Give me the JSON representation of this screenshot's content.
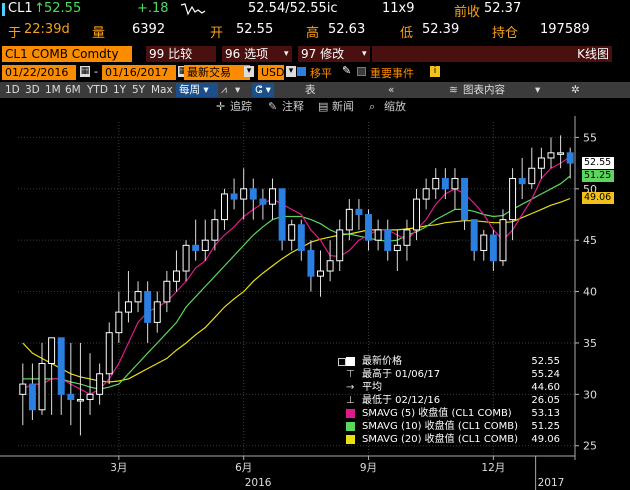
{
  "quote": {
    "ticker": "CL1",
    "last": "52.55",
    "change": "+.18",
    "bid_ask": "52.54/52.55ic",
    "size": "11x9",
    "prev_close_label": "前收",
    "prev_close": "52.37",
    "time_prefix": "于",
    "time": "22:39d",
    "volume_label": "量",
    "volume": "6392",
    "open_label": "开",
    "open": "52.55",
    "high_label": "高",
    "high": "52.63",
    "low_label": "低",
    "low": "52.39",
    "oi_label": "持仓",
    "oi": "197589"
  },
  "function_bar": {
    "security": "CL1 COMB Comdty",
    "compare": "99 比较",
    "options": "96 选项",
    "modify": "97 修改",
    "chart_name": "K线图"
  },
  "settings_bar": {
    "start_date": "01/22/2016",
    "end_date": "01/16/2017",
    "last_trade": "最新交易",
    "currency": "USD",
    "move_label": "移平",
    "events_label": "重要事件"
  },
  "period_bar": {
    "periods": [
      "1D",
      "3D",
      "1M",
      "6M",
      "YTD",
      "1Y",
      "5Y",
      "Max"
    ],
    "frequency": "每周",
    "table_label": "表",
    "chart_content": "图表内容"
  },
  "tools_bar": {
    "track": "追踪",
    "annotate": "注释",
    "news": "新闻",
    "zoom": "缩放"
  },
  "chart_data": {
    "type": "candlestick",
    "y_ticks": [
      25,
      30,
      35,
      40,
      45,
      50,
      55
    ],
    "ylim": [
      24,
      56.5
    ],
    "x_month_labels": [
      "3月",
      "6月",
      "9月",
      "12月"
    ],
    "x_year_labels": [
      "2016",
      "2017"
    ],
    "candles": [
      {
        "o": 30,
        "h": 33,
        "l": 27,
        "c": 31
      },
      {
        "o": 31,
        "h": 33,
        "l": 27.5,
        "c": 28.5
      },
      {
        "o": 28.5,
        "h": 35,
        "l": 28,
        "c": 33
      },
      {
        "o": 33,
        "h": 35,
        "l": 28,
        "c": 35.5
      },
      {
        "o": 35.5,
        "h": 35,
        "l": 28,
        "c": 30
      },
      {
        "o": 30,
        "h": 35,
        "l": 27,
        "c": 29.5
      },
      {
        "o": 29.5,
        "h": 35,
        "l": 26,
        "c": 29.5
      },
      {
        "o": 29.5,
        "h": 34,
        "l": 28,
        "c": 30
      },
      {
        "o": 30,
        "h": 33,
        "l": 29,
        "c": 32
      },
      {
        "o": 32,
        "h": 37,
        "l": 31,
        "c": 36
      },
      {
        "o": 36,
        "h": 40,
        "l": 35,
        "c": 38
      },
      {
        "o": 38,
        "h": 42,
        "l": 37,
        "c": 39
      },
      {
        "o": 39,
        "h": 41,
        "l": 38,
        "c": 40
      },
      {
        "o": 40,
        "h": 41,
        "l": 35,
        "c": 37
      },
      {
        "o": 37,
        "h": 40,
        "l": 36,
        "c": 39
      },
      {
        "o": 39,
        "h": 42,
        "l": 38,
        "c": 41
      },
      {
        "o": 41,
        "h": 44,
        "l": 40,
        "c": 42
      },
      {
        "o": 42,
        "h": 45,
        "l": 41,
        "c": 44.5
      },
      {
        "o": 44.5,
        "h": 47,
        "l": 43,
        "c": 44
      },
      {
        "o": 44,
        "h": 47,
        "l": 43,
        "c": 45
      },
      {
        "o": 45,
        "h": 48,
        "l": 44,
        "c": 47
      },
      {
        "o": 47,
        "h": 50,
        "l": 46,
        "c": 49.5
      },
      {
        "o": 49.5,
        "h": 51,
        "l": 48,
        "c": 49
      },
      {
        "o": 49,
        "h": 52,
        "l": 47,
        "c": 50
      },
      {
        "o": 50,
        "h": 51,
        "l": 47,
        "c": 49
      },
      {
        "o": 49,
        "h": 50,
        "l": 47,
        "c": 48.5
      },
      {
        "o": 48.5,
        "h": 51,
        "l": 47,
        "c": 50
      },
      {
        "o": 50,
        "h": 50,
        "l": 44,
        "c": 45
      },
      {
        "o": 45,
        "h": 47,
        "l": 44,
        "c": 46.5
      },
      {
        "o": 46.5,
        "h": 47,
        "l": 43,
        "c": 44
      },
      {
        "o": 44,
        "h": 45,
        "l": 40,
        "c": 41.5
      },
      {
        "o": 41.5,
        "h": 44,
        "l": 39.5,
        "c": 42
      },
      {
        "o": 42,
        "h": 45,
        "l": 41,
        "c": 43
      },
      {
        "o": 43,
        "h": 47,
        "l": 42,
        "c": 46
      },
      {
        "o": 46,
        "h": 49,
        "l": 45,
        "c": 48
      },
      {
        "o": 48,
        "h": 49,
        "l": 46,
        "c": 47.5
      },
      {
        "o": 47.5,
        "h": 48,
        "l": 44,
        "c": 45
      },
      {
        "o": 45,
        "h": 47,
        "l": 44,
        "c": 46
      },
      {
        "o": 46,
        "h": 47,
        "l": 43,
        "c": 44
      },
      {
        "o": 44,
        "h": 46,
        "l": 42,
        "c": 44.5
      },
      {
        "o": 44.5,
        "h": 47,
        "l": 43,
        "c": 46
      },
      {
        "o": 46,
        "h": 50,
        "l": 45,
        "c": 49
      },
      {
        "o": 49,
        "h": 51,
        "l": 48,
        "c": 50
      },
      {
        "o": 50,
        "h": 52,
        "l": 49,
        "c": 51
      },
      {
        "o": 51,
        "h": 52,
        "l": 49,
        "c": 50
      },
      {
        "o": 50,
        "h": 52,
        "l": 48,
        "c": 51
      },
      {
        "o": 51,
        "h": 50.5,
        "l": 46,
        "c": 47
      },
      {
        "o": 47,
        "h": 47,
        "l": 43,
        "c": 44
      },
      {
        "o": 44,
        "h": 46,
        "l": 43,
        "c": 45.5
      },
      {
        "o": 45.5,
        "h": 46,
        "l": 42,
        "c": 43
      },
      {
        "o": 43,
        "h": 48,
        "l": 42.5,
        "c": 47
      },
      {
        "o": 47,
        "h": 52,
        "l": 45,
        "c": 51
      },
      {
        "o": 51,
        "h": 53,
        "l": 49,
        "c": 50.5
      },
      {
        "o": 50.5,
        "h": 54,
        "l": 50,
        "c": 52
      },
      {
        "o": 52,
        "h": 54,
        "l": 51,
        "c": 53
      },
      {
        "o": 53,
        "h": 55,
        "l": 52,
        "c": 53.5
      },
      {
        "o": 53.5,
        "h": 55.2,
        "l": 52,
        "c": 53.5
      },
      {
        "o": 53.5,
        "h": 54,
        "l": 51,
        "c": 52.5
      }
    ],
    "sma5": [
      30.5,
      31,
      31,
      31.5,
      31.5,
      31,
      30.5,
      30,
      30.5,
      31.5,
      33,
      35,
      37,
      38,
      38.5,
      39,
      40,
      41,
      42.3,
      43,
      44.5,
      45.5,
      46.3,
      47.3,
      48,
      48.6,
      49,
      48.5,
      48,
      47.5,
      46,
      45,
      43.5,
      43.4,
      44,
      45,
      45.5,
      46,
      46,
      45.5,
      45,
      46,
      47,
      48.5,
      49.5,
      50,
      49.5,
      48.6,
      47.5,
      46,
      45,
      46,
      47.5,
      49,
      51,
      52,
      52.5,
      53.1
    ],
    "sma10": [
      31.5,
      31.5,
      31.5,
      31.5,
      31.5,
      31.2,
      31,
      30.7,
      30.5,
      30.7,
      31,
      32,
      33,
      34,
      35,
      36,
      37,
      38.5,
      39.5,
      40.5,
      41.5,
      42.5,
      43.5,
      44.5,
      45.5,
      46.3,
      47,
      47.3,
      47.3,
      47.3,
      47,
      46.6,
      46,
      45.6,
      45.6,
      45.4,
      45.2,
      45,
      44.9,
      45,
      45.5,
      45.8,
      46.3,
      47,
      47.5,
      48,
      48,
      47.8,
      47.5,
      47.3,
      47.4,
      48,
      48.5,
      49,
      49.5,
      50,
      50.5,
      51.25
    ],
    "sma20": [
      35,
      34,
      33.5,
      33,
      32.5,
      32,
      31.7,
      31.5,
      31.3,
      31.2,
      31.3,
      31.5,
      32,
      32.5,
      33,
      33.5,
      34.3,
      35,
      35.8,
      36.5,
      37.5,
      38.5,
      39.3,
      40,
      41,
      41.8,
      42.5,
      43.2,
      43.8,
      44.3,
      44.8,
      45.1,
      45.3,
      45.5,
      45.6,
      45.8,
      46,
      46,
      46,
      46,
      46.1,
      46.2,
      46.4,
      46.5,
      46.7,
      46.8,
      46.9,
      46.9,
      46.8,
      46.7,
      46.7,
      46.8,
      47.2,
      47.6,
      48,
      48.4,
      48.7,
      49.06
    ],
    "price_tags": [
      {
        "value": "52.55",
        "bg": "#ffffff",
        "fg": "#000000"
      },
      {
        "value": "51.25",
        "bg": "#5cd65c",
        "fg": "#000000"
      },
      {
        "value": "49.06",
        "bg": "#f2c21a",
        "fg": "#000000"
      }
    ],
    "colors": {
      "bull": "#ffffff",
      "bear": "#2b7fe0",
      "sma5": "#e0198c",
      "sma10": "#5cd65c",
      "sma20": "#e8e010",
      "grid": "#3a3a3a"
    }
  },
  "legend": {
    "rows": [
      {
        "label": "最新价格",
        "value": "52.55",
        "swatch": "#ffffff",
        "marker": "box"
      },
      {
        "label": "最高于 01/06/17",
        "value": "55.24",
        "swatch": "",
        "marker": "T"
      },
      {
        "label": "平均",
        "value": "44.60",
        "swatch": "",
        "marker": "arrow"
      },
      {
        "label": "最低于 02/12/16",
        "value": "26.05",
        "swatch": "",
        "marker": "bottom"
      },
      {
        "label": "SMAVG (5) 收盘值 (CL1 COMB)",
        "value": "53.13",
        "swatch": "#e0198c",
        "marker": "box"
      },
      {
        "label": "SMAVG (10) 收盘值 (CL1 COMB)",
        "value": "51.25",
        "swatch": "#5cd65c",
        "marker": "box"
      },
      {
        "label": "SMAVG (20) 收盘值 (CL1 COMB)",
        "value": "49.06",
        "swatch": "#e8e010",
        "marker": "box"
      }
    ]
  }
}
